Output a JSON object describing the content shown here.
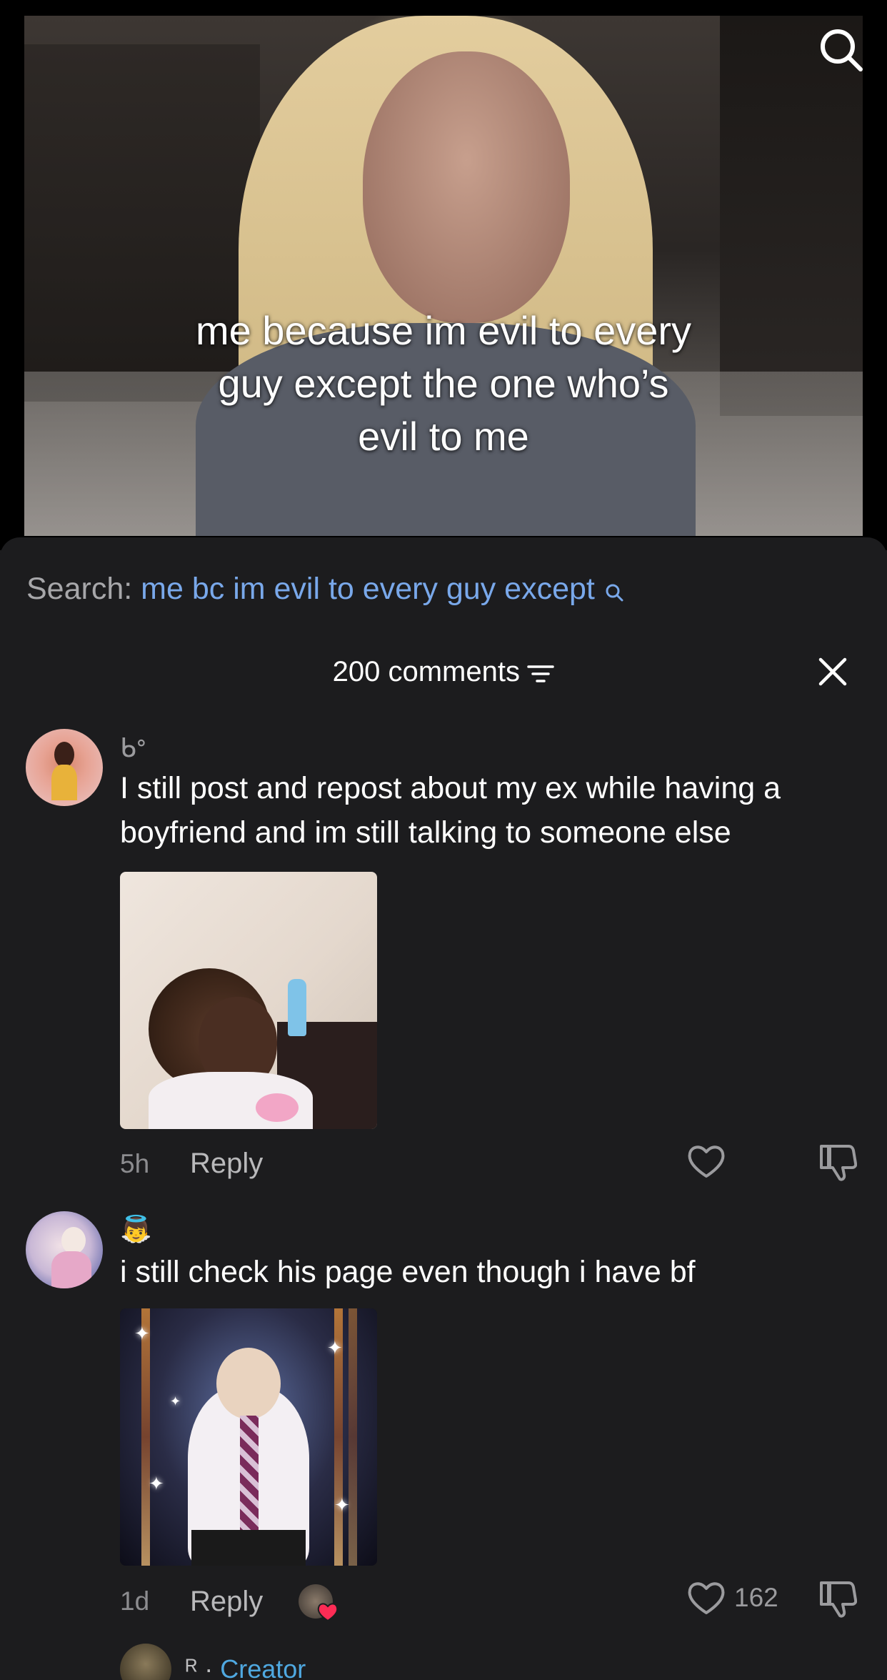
{
  "video": {
    "caption_line1": "me because im evil to every",
    "caption_line2": "guy except the one who’s",
    "caption_line3": "evil to me"
  },
  "search": {
    "label": "Search:",
    "query": "me bc im evil to every guy except"
  },
  "comments_header": {
    "count_label": "200 comments"
  },
  "comments": [
    {
      "username_glyph": "ᑲᐤ",
      "text": "I still post and repost about my ex while having a boyfriend and im still talking to someone else",
      "time": "5h",
      "reply_label": "Reply",
      "likes": ""
    },
    {
      "username_glyph": "👼",
      "text": "i still check his page even though i have bf",
      "time": "1d",
      "reply_label": "Reply",
      "likes": "162"
    }
  ],
  "partial_comment": {
    "symbol": "ᴿ ·",
    "creator_label": "Creator"
  },
  "colors": {
    "sheet_bg": "#1c1c1e",
    "query_blue": "#79a8ea",
    "creator_blue": "#4fa8e0",
    "muted": "#8c8c8f"
  }
}
